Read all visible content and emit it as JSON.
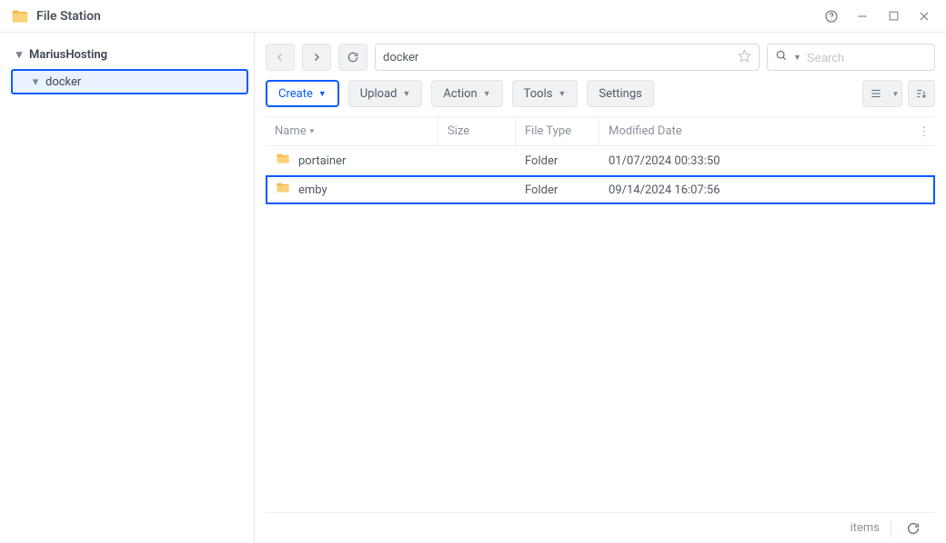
{
  "window": {
    "title": "File Station"
  },
  "tree": {
    "root_label": "MariusHosting",
    "children": [
      {
        "label": "docker",
        "selected": true
      }
    ]
  },
  "toolbar": {
    "path": "docker",
    "search_placeholder": "Search",
    "buttons": {
      "create": "Create",
      "upload": "Upload",
      "action": "Action",
      "tools": "Tools",
      "settings": "Settings"
    }
  },
  "table": {
    "columns": {
      "name": "Name",
      "size": "Size",
      "type": "File Type",
      "date": "Modified Date"
    },
    "rows": [
      {
        "name": "portainer",
        "size": "",
        "type": "Folder",
        "date": "01/07/2024 00:33:50",
        "highlight": false
      },
      {
        "name": "emby",
        "size": "",
        "type": "Folder",
        "date": "09/14/2024 16:07:56",
        "highlight": true
      }
    ]
  },
  "statusbar": {
    "items_label": "items"
  }
}
